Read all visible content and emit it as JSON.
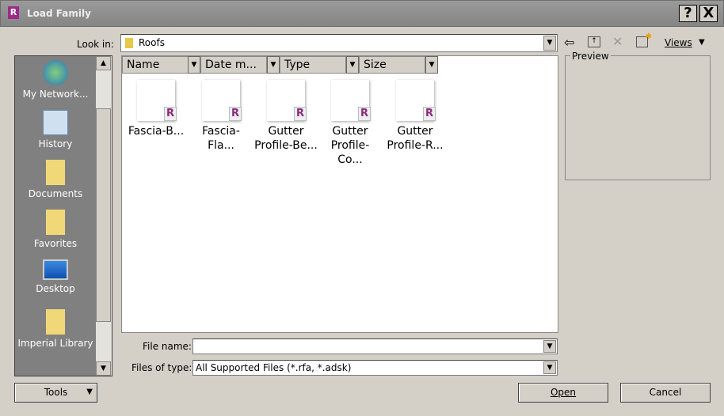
{
  "window": {
    "title": "Load Family",
    "help": "?",
    "close": "X"
  },
  "look_in": {
    "label": "Look in:",
    "value": "Roofs"
  },
  "toolbar": {
    "views_label": "Views"
  },
  "places": [
    {
      "label": "My Network..."
    },
    {
      "label": "History"
    },
    {
      "label": "Documents"
    },
    {
      "label": "Favorites"
    },
    {
      "label": "Desktop"
    },
    {
      "label": "Imperial Library"
    }
  ],
  "columns": [
    "Name",
    "Date m...",
    "Type",
    "Size"
  ],
  "files": [
    {
      "line1": "Fascia-B...",
      "line2": ""
    },
    {
      "line1": "Fascia-Fla...",
      "line2": ""
    },
    {
      "line1": "Gutter",
      "line2": "Profile-Be..."
    },
    {
      "line1": "Gutter",
      "line2": "Profile-Co..."
    },
    {
      "line1": "Gutter",
      "line2": "Profile-R..."
    }
  ],
  "preview": {
    "label": "Preview"
  },
  "file_name": {
    "label": "File name:",
    "value": ""
  },
  "files_of_type": {
    "label": "Files of type:",
    "value": "All Supported Files  (*.rfa,  *.adsk)"
  },
  "buttons": {
    "tools": "Tools",
    "open": "Open",
    "cancel": "Cancel"
  }
}
